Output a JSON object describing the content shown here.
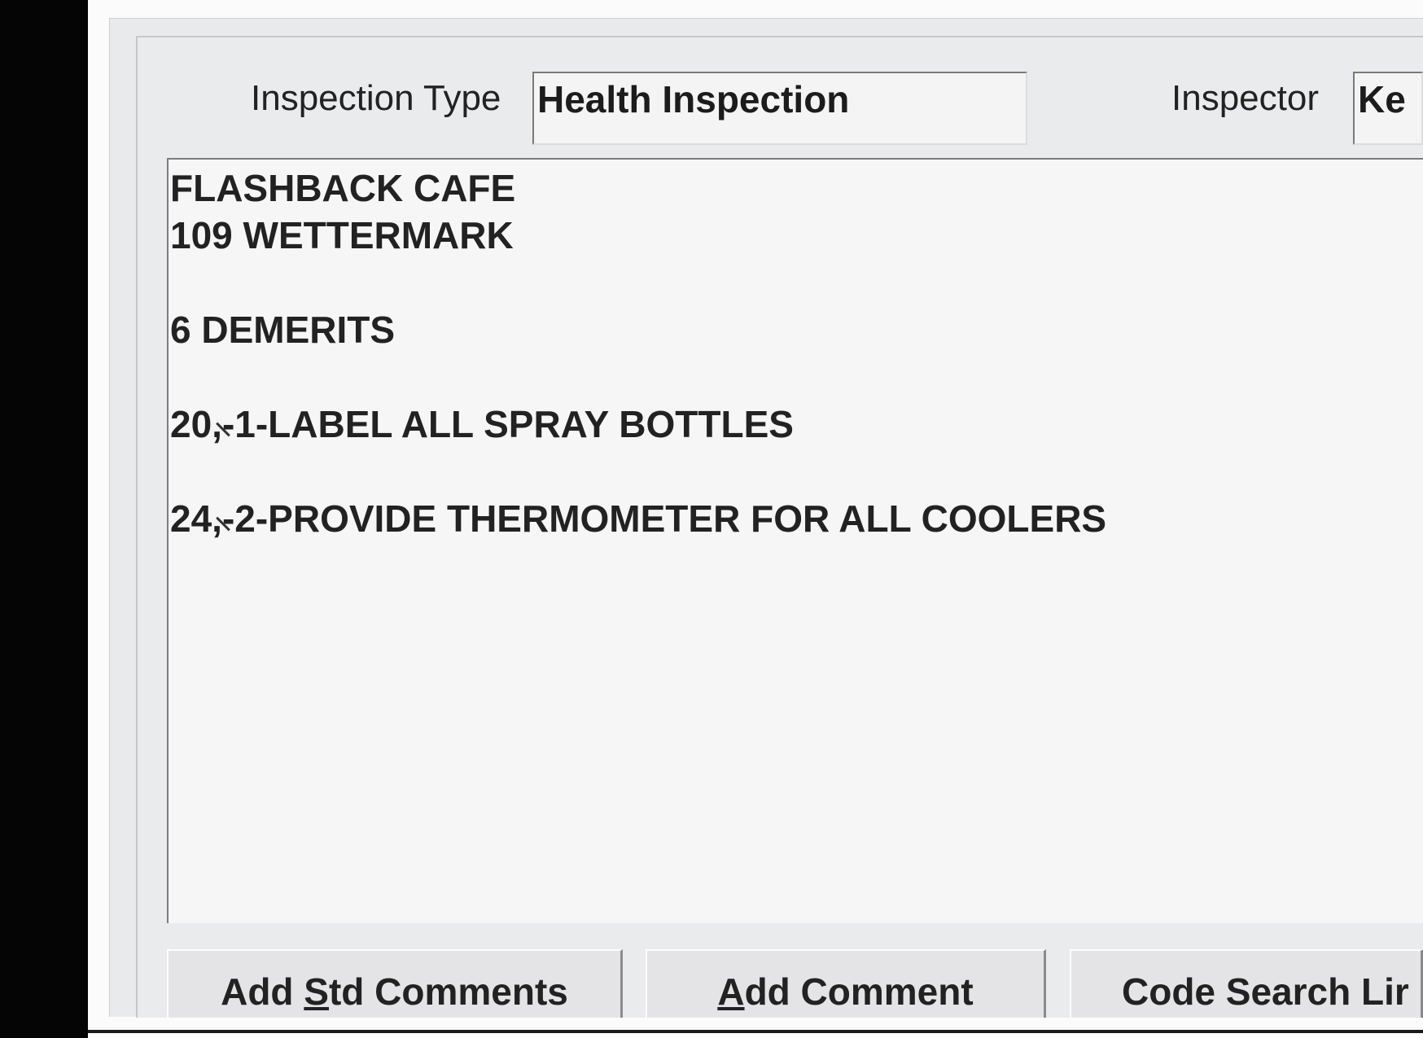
{
  "header": {
    "inspection_type_label": "Inspection Type",
    "inspection_type_value": "Health Inspection",
    "inspector_label": "Inspector",
    "inspector_value": "Ke"
  },
  "comments": {
    "lines": [
      "FLASHBACK CAFE",
      "109 WETTERMARK",
      "6 DEMERITS",
      "20,-1-LABEL ALL SPRAY BOTTLES",
      "24,-2-PROVIDE THERMOMETER FOR ALL COOLERS"
    ]
  },
  "buttons": {
    "add_std_comments": {
      "pre": "Add ",
      "accel": "S",
      "post": "td Comments"
    },
    "add_comment": {
      "pre": "",
      "accel": "A",
      "post": "dd Comment"
    },
    "code_search": {
      "label": "Code Search Lir"
    }
  }
}
